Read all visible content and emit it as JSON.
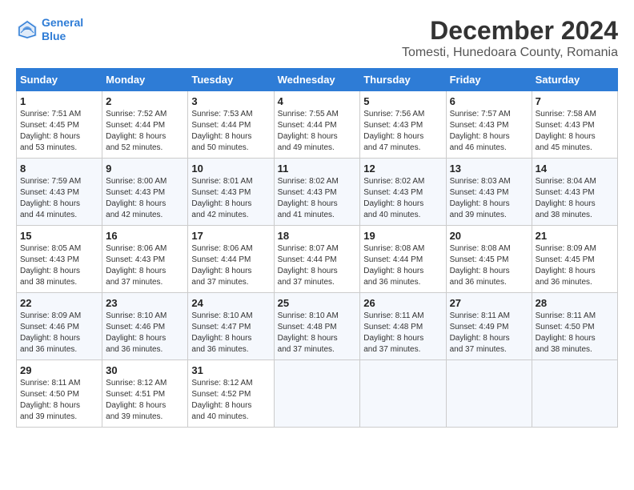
{
  "header": {
    "logo_line1": "General",
    "logo_line2": "Blue",
    "title": "December 2024",
    "subtitle": "Tomesti, Hunedoara County, Romania"
  },
  "weekdays": [
    "Sunday",
    "Monday",
    "Tuesday",
    "Wednesday",
    "Thursday",
    "Friday",
    "Saturday"
  ],
  "weeks": [
    [
      {
        "day": "1",
        "sunrise": "7:51 AM",
        "sunset": "4:45 PM",
        "daylight": "8 hours and 53 minutes."
      },
      {
        "day": "2",
        "sunrise": "7:52 AM",
        "sunset": "4:44 PM",
        "daylight": "8 hours and 52 minutes."
      },
      {
        "day": "3",
        "sunrise": "7:53 AM",
        "sunset": "4:44 PM",
        "daylight": "8 hours and 50 minutes."
      },
      {
        "day": "4",
        "sunrise": "7:55 AM",
        "sunset": "4:44 PM",
        "daylight": "8 hours and 49 minutes."
      },
      {
        "day": "5",
        "sunrise": "7:56 AM",
        "sunset": "4:43 PM",
        "daylight": "8 hours and 47 minutes."
      },
      {
        "day": "6",
        "sunrise": "7:57 AM",
        "sunset": "4:43 PM",
        "daylight": "8 hours and 46 minutes."
      },
      {
        "day": "7",
        "sunrise": "7:58 AM",
        "sunset": "4:43 PM",
        "daylight": "8 hours and 45 minutes."
      }
    ],
    [
      {
        "day": "8",
        "sunrise": "7:59 AM",
        "sunset": "4:43 PM",
        "daylight": "8 hours and 44 minutes."
      },
      {
        "day": "9",
        "sunrise": "8:00 AM",
        "sunset": "4:43 PM",
        "daylight": "8 hours and 42 minutes."
      },
      {
        "day": "10",
        "sunrise": "8:01 AM",
        "sunset": "4:43 PM",
        "daylight": "8 hours and 42 minutes."
      },
      {
        "day": "11",
        "sunrise": "8:02 AM",
        "sunset": "4:43 PM",
        "daylight": "8 hours and 41 minutes."
      },
      {
        "day": "12",
        "sunrise": "8:02 AM",
        "sunset": "4:43 PM",
        "daylight": "8 hours and 40 minutes."
      },
      {
        "day": "13",
        "sunrise": "8:03 AM",
        "sunset": "4:43 PM",
        "daylight": "8 hours and 39 minutes."
      },
      {
        "day": "14",
        "sunrise": "8:04 AM",
        "sunset": "4:43 PM",
        "daylight": "8 hours and 38 minutes."
      }
    ],
    [
      {
        "day": "15",
        "sunrise": "8:05 AM",
        "sunset": "4:43 PM",
        "daylight": "8 hours and 38 minutes."
      },
      {
        "day": "16",
        "sunrise": "8:06 AM",
        "sunset": "4:43 PM",
        "daylight": "8 hours and 37 minutes."
      },
      {
        "day": "17",
        "sunrise": "8:06 AM",
        "sunset": "4:44 PM",
        "daylight": "8 hours and 37 minutes."
      },
      {
        "day": "18",
        "sunrise": "8:07 AM",
        "sunset": "4:44 PM",
        "daylight": "8 hours and 37 minutes."
      },
      {
        "day": "19",
        "sunrise": "8:08 AM",
        "sunset": "4:44 PM",
        "daylight": "8 hours and 36 minutes."
      },
      {
        "day": "20",
        "sunrise": "8:08 AM",
        "sunset": "4:45 PM",
        "daylight": "8 hours and 36 minutes."
      },
      {
        "day": "21",
        "sunrise": "8:09 AM",
        "sunset": "4:45 PM",
        "daylight": "8 hours and 36 minutes."
      }
    ],
    [
      {
        "day": "22",
        "sunrise": "8:09 AM",
        "sunset": "4:46 PM",
        "daylight": "8 hours and 36 minutes."
      },
      {
        "day": "23",
        "sunrise": "8:10 AM",
        "sunset": "4:46 PM",
        "daylight": "8 hours and 36 minutes."
      },
      {
        "day": "24",
        "sunrise": "8:10 AM",
        "sunset": "4:47 PM",
        "daylight": "8 hours and 36 minutes."
      },
      {
        "day": "25",
        "sunrise": "8:10 AM",
        "sunset": "4:48 PM",
        "daylight": "8 hours and 37 minutes."
      },
      {
        "day": "26",
        "sunrise": "8:11 AM",
        "sunset": "4:48 PM",
        "daylight": "8 hours and 37 minutes."
      },
      {
        "day": "27",
        "sunrise": "8:11 AM",
        "sunset": "4:49 PM",
        "daylight": "8 hours and 37 minutes."
      },
      {
        "day": "28",
        "sunrise": "8:11 AM",
        "sunset": "4:50 PM",
        "daylight": "8 hours and 38 minutes."
      }
    ],
    [
      {
        "day": "29",
        "sunrise": "8:11 AM",
        "sunset": "4:50 PM",
        "daylight": "8 hours and 39 minutes."
      },
      {
        "day": "30",
        "sunrise": "8:12 AM",
        "sunset": "4:51 PM",
        "daylight": "8 hours and 39 minutes."
      },
      {
        "day": "31",
        "sunrise": "8:12 AM",
        "sunset": "4:52 PM",
        "daylight": "8 hours and 40 minutes."
      },
      null,
      null,
      null,
      null
    ]
  ]
}
